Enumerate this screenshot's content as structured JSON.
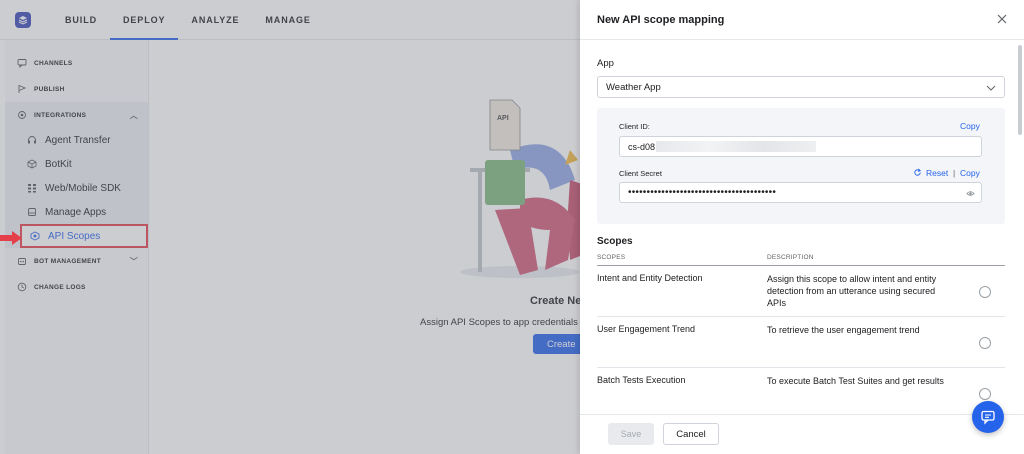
{
  "topnav": {
    "items": [
      {
        "label": "BUILD"
      },
      {
        "label": "DEPLOY",
        "active": true
      },
      {
        "label": "ANALYZE"
      },
      {
        "label": "MANAGE"
      }
    ]
  },
  "sidebar": {
    "channels": "CHANNELS",
    "publish": "PUBLISH",
    "integrations": "INTEGRATIONS",
    "integration_items": [
      {
        "label": "Agent Transfer",
        "icon": "headset-icon"
      },
      {
        "label": "BotKit",
        "icon": "cube-icon"
      },
      {
        "label": "Web/Mobile SDK",
        "icon": "sdk-icon"
      },
      {
        "label": "Manage Apps",
        "icon": "apps-icon"
      },
      {
        "label": "API Scopes",
        "icon": "scope-icon",
        "active": true
      }
    ],
    "bot_management": "BOT MANAGEMENT",
    "change_logs": "CHANGE LOGS"
  },
  "empty_state": {
    "title": "Create Ne",
    "description": "Assign API Scopes to app credentials",
    "button": "Create"
  },
  "drawer": {
    "title": "New API scope mapping",
    "app_label": "App",
    "app_value": "Weather App",
    "client_id_label": "Client ID:",
    "client_id_value": "cs-d08",
    "copy_label": "Copy",
    "client_secret_label": "Client Secret",
    "reset_label": "Reset",
    "separator": "|",
    "secret_mask": "••••••••••••••••••••••••••••••••••••••••",
    "scopes_title": "Scopes",
    "col_scopes": "SCOPES",
    "col_description": "DESCRIPTION",
    "scopes": [
      {
        "name": "Intent and Entity Detection",
        "description": "Assign this scope to allow intent and entity detection from an utterance using secured APIs"
      },
      {
        "name": "User Engagement Trend",
        "description": "To retrieve the user engagement trend"
      },
      {
        "name": "Batch Tests Execution",
        "description": "To execute Batch Test Suites and get results"
      }
    ],
    "save_label": "Save",
    "cancel_label": "Cancel"
  },
  "colors": {
    "accent": "#2563eb",
    "annotation_red": "#e5404a"
  }
}
